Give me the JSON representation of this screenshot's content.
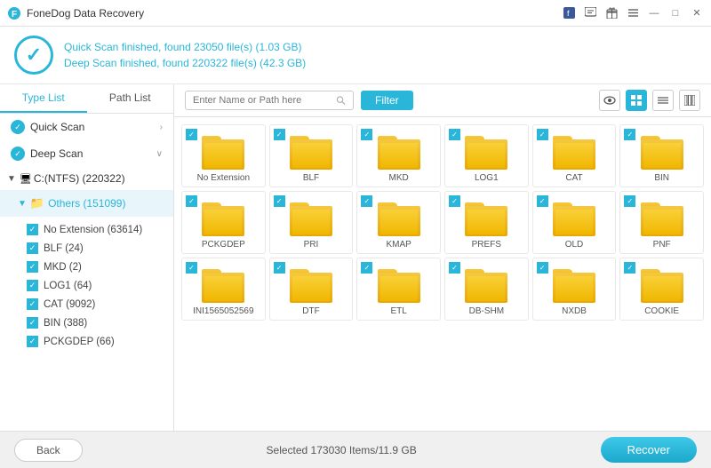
{
  "titleBar": {
    "title": "FoneDog Data Recovery",
    "controls": [
      "facebook-icon",
      "message-icon",
      "gift-icon",
      "menu-icon",
      "minimize-icon",
      "maximize-icon",
      "close-icon"
    ]
  },
  "header": {
    "quickScan": "Quick Scan finished, found ",
    "quickScanFiles": "23050 file(s)",
    "quickScanSize": " (1.03 GB)",
    "deepScan": "Deep Scan finished, found ",
    "deepScanFiles": "220322 file(s)",
    "deepScanSize": " (42.3 GB)"
  },
  "sidebar": {
    "tab1": "Type List",
    "tab2": "Path List",
    "items": [
      {
        "label": "Quick Scan",
        "chevron": "›"
      },
      {
        "label": "Deep Scan",
        "chevron": "∨"
      }
    ],
    "drive": "C:(NTFS) (220322)",
    "folder": "Others (151099)",
    "subItems": [
      {
        "label": "No Extension (63614)"
      },
      {
        "label": "BLF (24)"
      },
      {
        "label": "MKD (2)"
      },
      {
        "label": "LOG1 (64)"
      },
      {
        "label": "CAT (9092)"
      },
      {
        "label": "BIN (388)"
      },
      {
        "label": "PCKGDEP (66)"
      }
    ]
  },
  "toolbar": {
    "searchPlaceholder": "Enter Name or Path here",
    "filterLabel": "Filter",
    "viewIcons": [
      "eye-icon",
      "grid-icon",
      "list-icon",
      "columns-icon"
    ]
  },
  "fileGrid": {
    "files": [
      {
        "label": "No Extension"
      },
      {
        "label": "BLF"
      },
      {
        "label": "MKD"
      },
      {
        "label": "LOG1"
      },
      {
        "label": "CAT"
      },
      {
        "label": "BIN"
      },
      {
        "label": "PCKGDEP"
      },
      {
        "label": "PRI"
      },
      {
        "label": "KMAP"
      },
      {
        "label": "PREFS"
      },
      {
        "label": "OLD"
      },
      {
        "label": "PNF"
      },
      {
        "label": "INI1565052569"
      },
      {
        "label": "DTF"
      },
      {
        "label": "ETL"
      },
      {
        "label": "DB-SHM"
      },
      {
        "label": "NXDB"
      },
      {
        "label": "COOKIE"
      }
    ]
  },
  "bottomBar": {
    "backLabel": "Back",
    "selectedInfo": "Selected 173030 Items/11.9 GB",
    "recoverLabel": "Recover"
  }
}
